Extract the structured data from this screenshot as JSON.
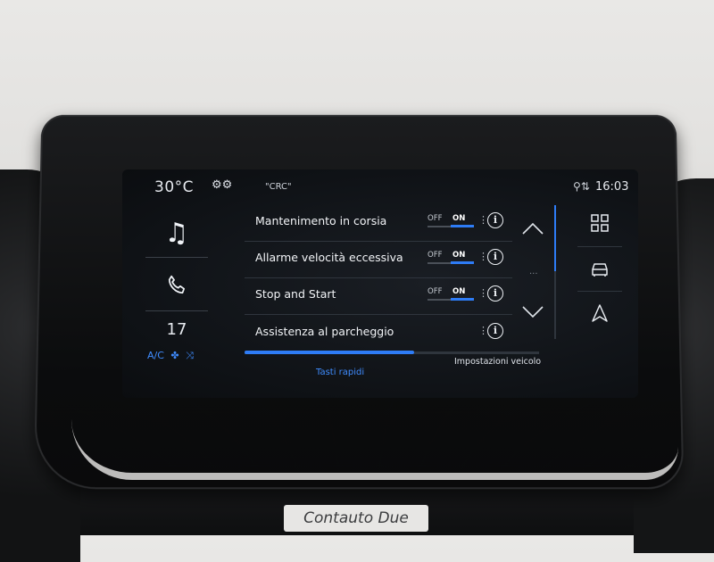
{
  "topbar": {
    "temperature": "30°C",
    "crc": "\"CRC\"",
    "clock": "16:03"
  },
  "left_column": {
    "music_icon": "music-note",
    "phone_icon": "phone",
    "fan_speed": "17",
    "ac_label": "A/C"
  },
  "settings": [
    {
      "label": "Mantenimento in corsia",
      "toggle": {
        "off": "OFF",
        "on": "ON",
        "state": "on"
      }
    },
    {
      "label": "Allarme velocità eccessiva",
      "toggle": {
        "off": "OFF",
        "on": "ON",
        "state": "on"
      }
    },
    {
      "label": "Stop and Start",
      "toggle": {
        "off": "OFF",
        "on": "ON",
        "state": "on"
      }
    },
    {
      "label": "Assistenza al parcheggio"
    }
  ],
  "info_glyph": "i",
  "right_column": [
    "apps-grid-icon",
    "car-icon",
    "navigation-arrow-icon"
  ],
  "tabs": {
    "active": "Tasti rapidi",
    "inactive": "Impostazioni veicolo"
  },
  "watermark": "Contauto Due",
  "colors": {
    "accent": "#2e7cf6",
    "screen_bg": "#0f1216",
    "text": "#f2f4f7"
  }
}
